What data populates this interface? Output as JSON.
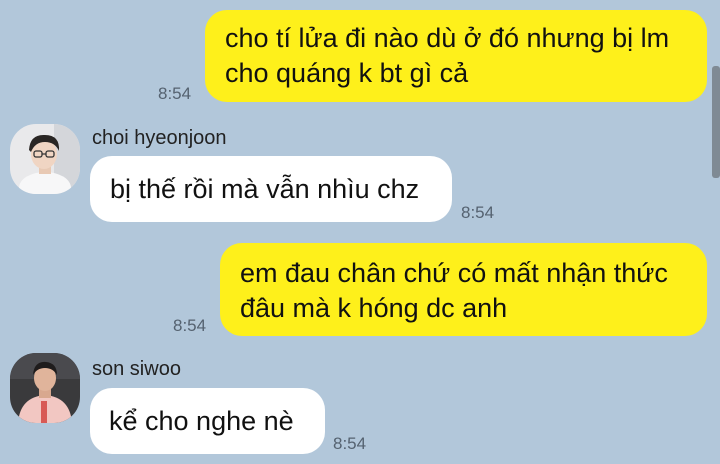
{
  "messages": [
    {
      "lines": [
        "cho tí lửa đi nào dù ở đó nhưng bị lm",
        "cho quáng k bt gì cả"
      ],
      "time": "8:54"
    },
    {
      "sender": "choi hyeonjoon",
      "lines": [
        "bị thế rồi mà vẫn nhìu chz"
      ],
      "time": "8:54"
    },
    {
      "lines": [
        "em đau chân chứ có mất nhận thức",
        "đâu mà k hóng dc anh"
      ],
      "time": "8:54"
    },
    {
      "sender": "son siwoo",
      "lines": [
        "kể cho nghe nè"
      ],
      "time": "8:54"
    }
  ],
  "colors": {
    "background": "#b2c7da",
    "my_bubble": "#fef01b",
    "their_bubble": "#ffffff"
  }
}
